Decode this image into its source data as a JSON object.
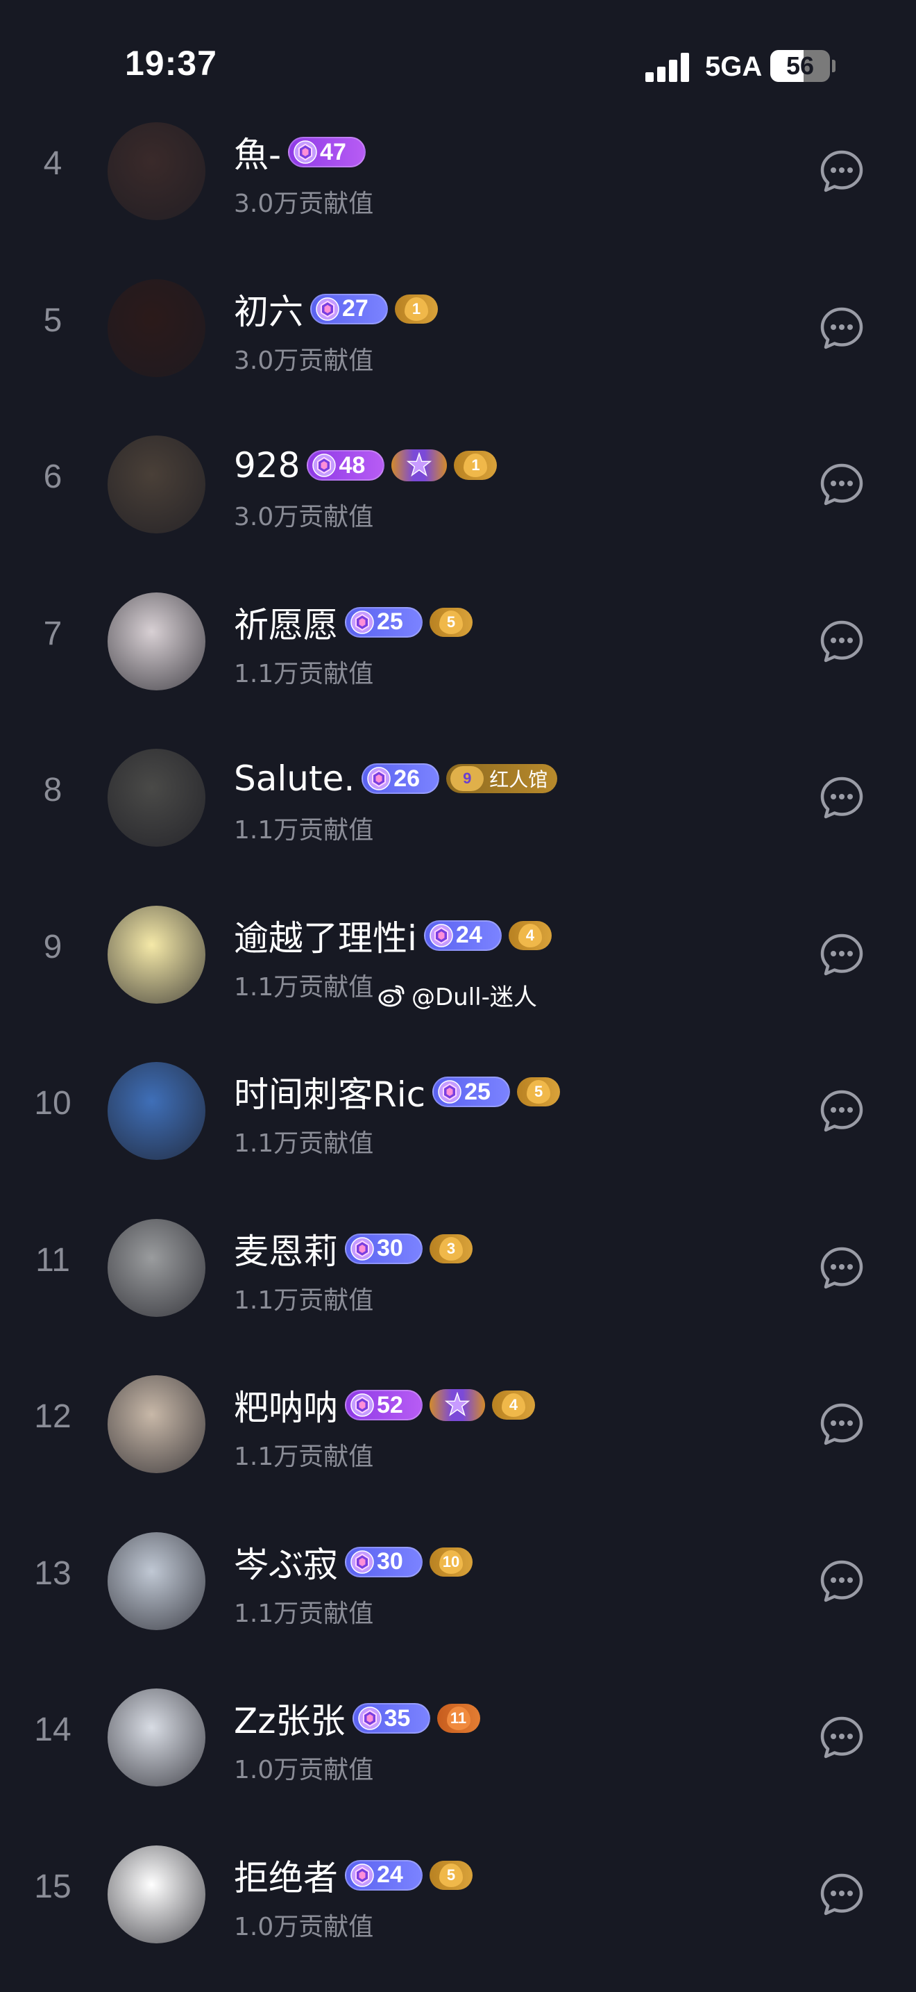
{
  "status_bar": {
    "time": "19:37",
    "network": "5GA",
    "battery": "56",
    "battery_level_percent": 56
  },
  "contribution_list": [
    {
      "rank": "4",
      "name": "魚-",
      "level": "47",
      "level_style": "purple",
      "extra_badge": null,
      "contribution": "3.0万贡献值",
      "avatar_color": "#3a2a2a"
    },
    {
      "rank": "5",
      "name": "初六",
      "level": "27",
      "level_style": "blue",
      "extra_badge": {
        "type": "fan",
        "value": "1"
      },
      "contribution": "3.0万贡献值",
      "avatar_color": "#2b1a1a"
    },
    {
      "rank": "6",
      "name": "928",
      "level": "48",
      "level_style": "purple",
      "extra_badge": {
        "type": "star_fan",
        "value": "1"
      },
      "contribution": "3.0万贡献值",
      "avatar_color": "#4a4038"
    },
    {
      "rank": "7",
      "name": "祈愿愿",
      "level": "25",
      "level_style": "blue",
      "extra_badge": {
        "type": "fan",
        "value": "5"
      },
      "contribution": "1.1万贡献值",
      "avatar_color": "#d8d0d4"
    },
    {
      "rank": "8",
      "name": "Salute.",
      "level": "26",
      "level_style": "blue",
      "extra_badge": {
        "type": "club",
        "value": "9",
        "label": "红人馆"
      },
      "contribution": "1.1万贡献值",
      "avatar_color": "#4a4a48"
    },
    {
      "rank": "9",
      "name": "逾越了理性i",
      "level": "24",
      "level_style": "blue",
      "extra_badge": {
        "type": "fan",
        "value": "4"
      },
      "contribution": "1.1万贡献值",
      "avatar_color": "#f5e9a8"
    },
    {
      "rank": "10",
      "name": "时间刺客Ric",
      "level": "25",
      "level_style": "blue",
      "extra_badge": {
        "type": "fan",
        "value": "5"
      },
      "contribution": "1.1万贡献值",
      "avatar_color": "#3f6fb8"
    },
    {
      "rank": "11",
      "name": "麦恩莉",
      "level": "30",
      "level_style": "blue",
      "extra_badge": {
        "type": "fan",
        "value": "3"
      },
      "contribution": "1.1万贡献值",
      "avatar_color": "#9a9c9e"
    },
    {
      "rank": "12",
      "name": "粑呐呐",
      "level": "52",
      "level_style": "purple",
      "extra_badge": {
        "type": "star_fan",
        "value": "4"
      },
      "contribution": "1.1万贡献值",
      "avatar_color": "#c8b8a8"
    },
    {
      "rank": "13",
      "name": "岑ぶ寂",
      "level": "30",
      "level_style": "blue",
      "extra_badge": {
        "type": "fan",
        "value": "10"
      },
      "contribution": "1.1万贡献值",
      "avatar_color": "#c0c8d4"
    },
    {
      "rank": "14",
      "name": "Zz张张",
      "level": "35",
      "level_style": "blue",
      "extra_badge": {
        "type": "fan_orange",
        "value": "11"
      },
      "contribution": "1.0万贡献值",
      "avatar_color": "#d8dce4"
    },
    {
      "rank": "15",
      "name": "拒绝者",
      "level": "24",
      "level_style": "blue",
      "extra_badge": {
        "type": "fan",
        "value": "5"
      },
      "contribution": "1.0万贡献值",
      "avatar_color": "#ffffff"
    }
  ],
  "watermark": "@Dull-迷人",
  "icons": {
    "chat": "chat-bubble-icon",
    "level": "gem-icon",
    "fan": "heart-icon",
    "weibo": "weibo-icon"
  },
  "colors": {
    "background": "#171923",
    "secondary_text": "#8b8d97",
    "level_blue": "#6a72f6",
    "level_purple": "#a24cee",
    "fan_gold": "#c8922e"
  }
}
